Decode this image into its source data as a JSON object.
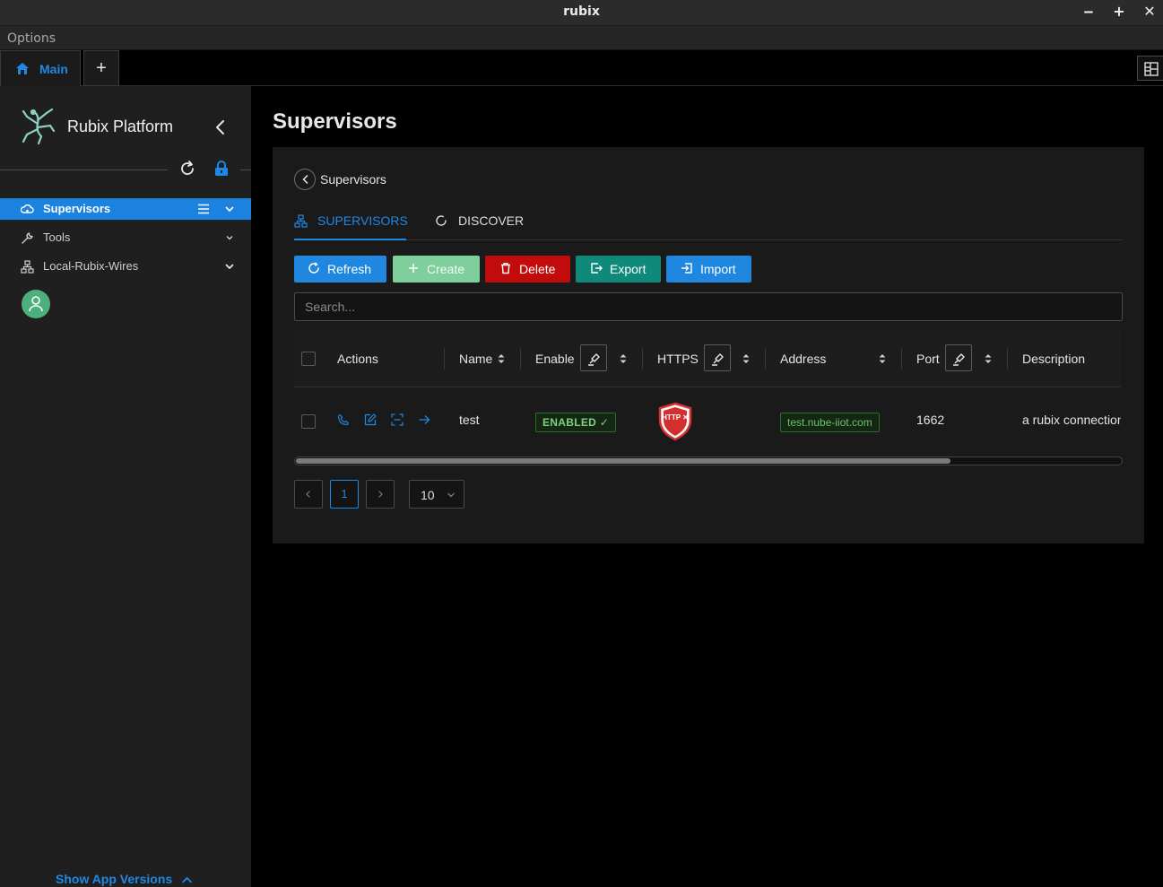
{
  "window": {
    "title": "rubix",
    "minimize_label": "‒",
    "maximize_label": "+",
    "close_label": "✕"
  },
  "menubar": {
    "options_label": "Options"
  },
  "tabs": {
    "main_label": "Main",
    "add_label": "+"
  },
  "sidebar": {
    "brand": "Rubix Platform",
    "items": [
      {
        "label": "Supervisors",
        "active": true
      },
      {
        "label": "Tools"
      },
      {
        "label": "Local-Rubix-Wires"
      }
    ],
    "show_versions_label": "Show App Versions"
  },
  "page": {
    "title": "Supervisors",
    "breadcrumb": "Supervisors",
    "tabs": [
      {
        "label": "SUPERVISORS",
        "active": true
      },
      {
        "label": "DISCOVER"
      }
    ],
    "toolbar": {
      "refresh": "Refresh",
      "create": "Create",
      "delete": "Delete",
      "export": "Export",
      "import": "Import"
    },
    "search_placeholder": "Search...",
    "columns": [
      "Actions",
      "Name",
      "Enable",
      "HTTPS",
      "Address",
      "Port",
      "Description"
    ],
    "rows": [
      {
        "name": "test",
        "enable": "ENABLED ✓",
        "https": "HTTP ✕",
        "address": "test.nube-iiot.com",
        "port": "1662",
        "description": "a rubix connection"
      }
    ],
    "pagination": {
      "current": "1",
      "page_size": "10"
    }
  },
  "colors": {
    "accent": "#1e88e5",
    "create": "#7fcf9c",
    "delete": "#c20c0c",
    "export": "#0f8a7a",
    "import": "#1f87e0",
    "enabled_green": "#7fd17f",
    "https_red": "#d32f2f"
  },
  "icons": {
    "home": "home-icon",
    "brand": "frog-logo-icon",
    "refresh": "refresh-icon",
    "lock": "lock-icon"
  }
}
